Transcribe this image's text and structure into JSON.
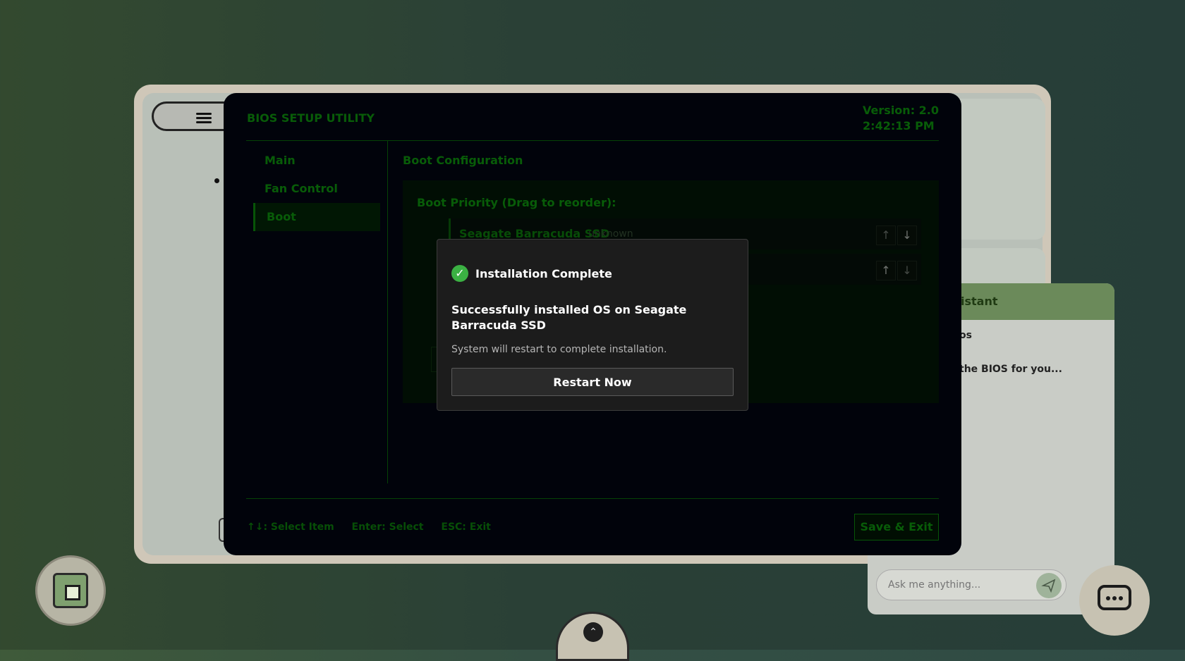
{
  "bios": {
    "title": "BIOS SETUP UTILITY",
    "version": "Version: 2.0",
    "time": "2:42:13 PM",
    "nav": [
      {
        "label": "Main"
      },
      {
        "label": "Fan Control"
      },
      {
        "label": "Boot",
        "active": true
      }
    ],
    "section_title": "Boot Configuration",
    "boot_priority_label": "Boot Priority (Drag to reorder):",
    "boot_devices": [
      {
        "name": "Seagate Barracuda SSD",
        "status": "unknown"
      },
      {
        "name": "",
        "status": ""
      }
    ],
    "footer_hints": [
      "↑↓: Select Item",
      "Enter: Select",
      "ESC: Exit"
    ],
    "save_exit_label": "Save & Exit"
  },
  "modal": {
    "icon": "check-circle-icon",
    "title": "Installation Complete",
    "message": "Successfully installed OS on Seagate Barracuda SSD",
    "sub": "System will restart to complete installation.",
    "button": "Restart Now"
  },
  "assistant": {
    "header": "istant",
    "msg1": "os",
    "msg2": "the BIOS for you...",
    "input_placeholder": "Ask me anything..."
  },
  "colors": {
    "bios_green": "#10a810",
    "bios_bg": "#030614",
    "success": "#3bb143"
  }
}
